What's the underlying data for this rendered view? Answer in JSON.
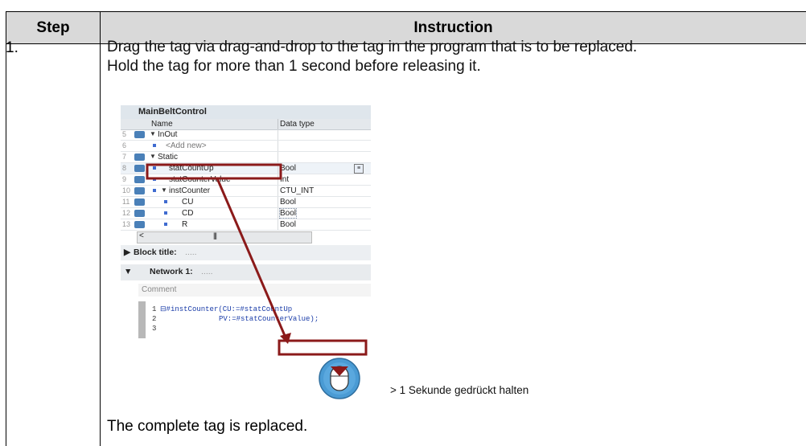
{
  "top_text": "Drag the tag via drag-and-drop...",
  "table": {
    "header_step": "Step",
    "header_instruction": "Instruction",
    "step_number": "1.",
    "instruction_line1": "Drag the tag via drag-and-drop to the tag in the program that is to be replaced.",
    "instruction_line2": "Hold the tag for more than 1 second before releasing it.",
    "result": "The complete tag is replaced."
  },
  "screenshot": {
    "block_name": "MainBeltControl",
    "col_name": "Name",
    "col_datatype": "Data type",
    "rows": [
      {
        "num": "5",
        "name": "InOut",
        "type": ""
      },
      {
        "num": "6",
        "name": "<Add new>",
        "type": ""
      },
      {
        "num": "7",
        "name": "Static",
        "type": ""
      },
      {
        "num": "8",
        "name": "statCountUp",
        "type": "Bool"
      },
      {
        "num": "9",
        "name": "statCounterValue",
        "type": "Int"
      },
      {
        "num": "10",
        "name": "instCounter",
        "type": "CTU_INT"
      },
      {
        "num": "11",
        "name": "CU",
        "type": "Bool"
      },
      {
        "num": "12",
        "name": "CD",
        "type": "Bool"
      },
      {
        "num": "13",
        "name": "R",
        "type": "Bool"
      }
    ],
    "block_title_label": "Block title:",
    "block_title_value": ".....",
    "network_label": "Network 1:",
    "network_value": ".....",
    "comment_placeholder": "Comment",
    "code_line1_num": "1",
    "code_line1": "#instCounter(CU:=#statCountUp",
    "code_line2_num": "2",
    "code_line2": "PV:=#statCounterValue);",
    "code_line3_num": "3"
  },
  "hold_note": "> 1 Sekunde gedrückt halten",
  "colors": {
    "header_bg": "#d9d9d9",
    "highlight": "#8b1a1a",
    "mouse_icon": "#4a9bd4"
  }
}
